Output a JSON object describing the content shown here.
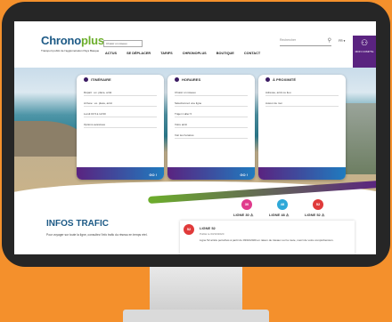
{
  "site": {
    "logo_main": "Chr",
    "logo_o": "o",
    "logo_rest": "no",
    "logo_plus": "plus",
    "tagline": "Transport public de l'agglomération Pays Basque",
    "select_label": "Choisir un réseau"
  },
  "nav": [
    "ACTUS",
    "SE DÉPLACER",
    "TARIFS",
    "CHRONOPLUS",
    "BOUTIQUE",
    "CONTACT"
  ],
  "search": {
    "placeholder": "Rechercher",
    "lang": "FR ▾"
  },
  "account": {
    "label": "MON COMPTE"
  },
  "cards": [
    {
      "title": "ITINÉRAIRE",
      "rows": [
        "Départ : ex. place, arrêt",
        "Arrivée : ex. place, arrêt",
        "Lundi 03  ▾   à  12:00",
        "Options avancées"
      ],
      "go": "GO !"
    },
    {
      "title": "HORAIRES",
      "rows": [
        "Choisir un réseau",
        "Sélectionnez une ligne",
        "Trajet 1 aller  ▾",
        "Votre arrêt",
        "Voir les horaires"
      ],
      "go": "GO !"
    },
    {
      "title": "À PROXIMITÉ",
      "rows": [
        "Adresse, arrêt ou lieu",
        "Autour de moi"
      ],
      "go": ""
    }
  ],
  "traffic": {
    "title": "INFOS TRAFIC",
    "text": "Pour voyager sur toute la ligne, consultez l'info trafic du réseau en temps réel."
  },
  "lines": [
    {
      "num": "30",
      "label": "LIGNE 30 ⚠",
      "color": "#e03a8c"
    },
    {
      "num": "48",
      "label": "LIGNE 48 ⚠",
      "color": "#2ea8d8"
    },
    {
      "num": "52",
      "label": "LIGNE 52 ⚠",
      "color": "#e03a3a"
    }
  ],
  "alert": {
    "num": "52",
    "title": "LIGNE 52",
    "date": "Publié le 03/10/2020",
    "body": "Ligne 52 arrêts perturbés à partir du 03/10/2020 en raison de travaux sur la route, merci de votre compréhension."
  }
}
